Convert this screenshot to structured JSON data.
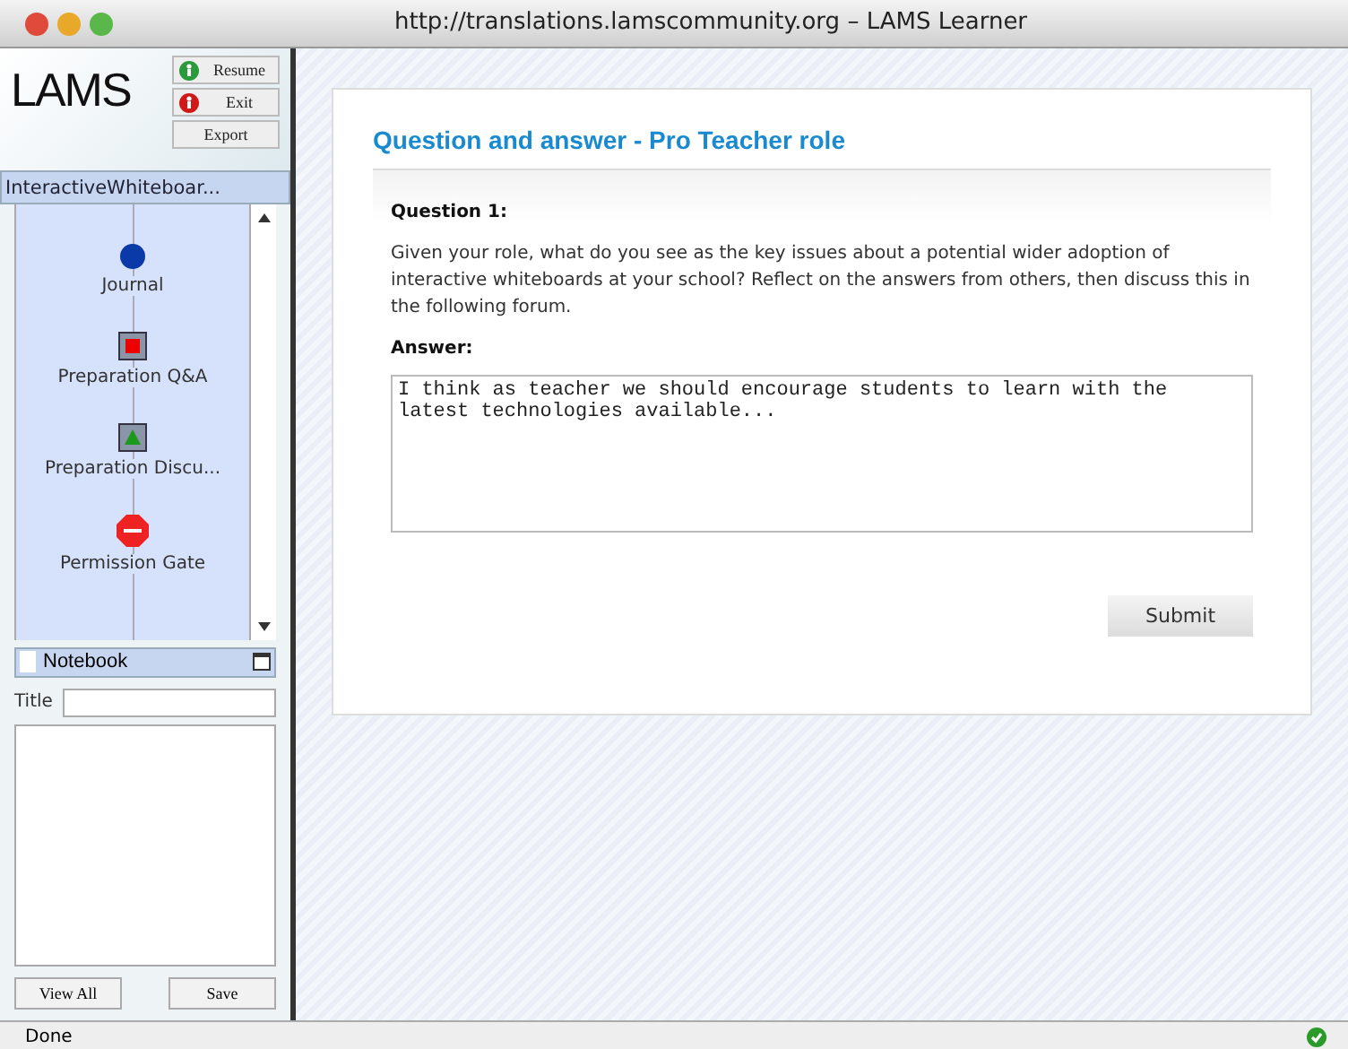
{
  "window": {
    "title": "http://translations.lamscommunity.org – LAMS Learner"
  },
  "sidebar": {
    "logo": "LAMS",
    "buttons": [
      {
        "label": "Resume",
        "kind": "go"
      },
      {
        "label": "Exit",
        "kind": "stop"
      },
      {
        "label": "Export",
        "kind": "plain"
      }
    ],
    "sequence_title": "InteractiveWhiteboar...",
    "activities": [
      {
        "label": "Journal",
        "kind": "circle"
      },
      {
        "label": "Preparation Q&A",
        "kind": "square"
      },
      {
        "label": "Preparation Discu...",
        "kind": "triangle"
      },
      {
        "label": "Permission Gate",
        "kind": "stop"
      }
    ],
    "notebook": {
      "header": "Notebook",
      "title_label": "Title",
      "buttons": [
        "View All",
        "Save"
      ]
    }
  },
  "main": {
    "heading": "Question and answer - Pro Teacher role",
    "question_label": "Question 1:",
    "question_text": "Given your role, what do you see as the key issues about a potential wider adoption of interactive whiteboards at your school? Reflect on the answers from others, then discuss this in the following forum.",
    "answer_label": "Answer:",
    "answer": "I think as teacher we should encourage students to learn with the latest technologies available...",
    "submit": "Submit"
  },
  "status_bar": {
    "text": "Done"
  }
}
